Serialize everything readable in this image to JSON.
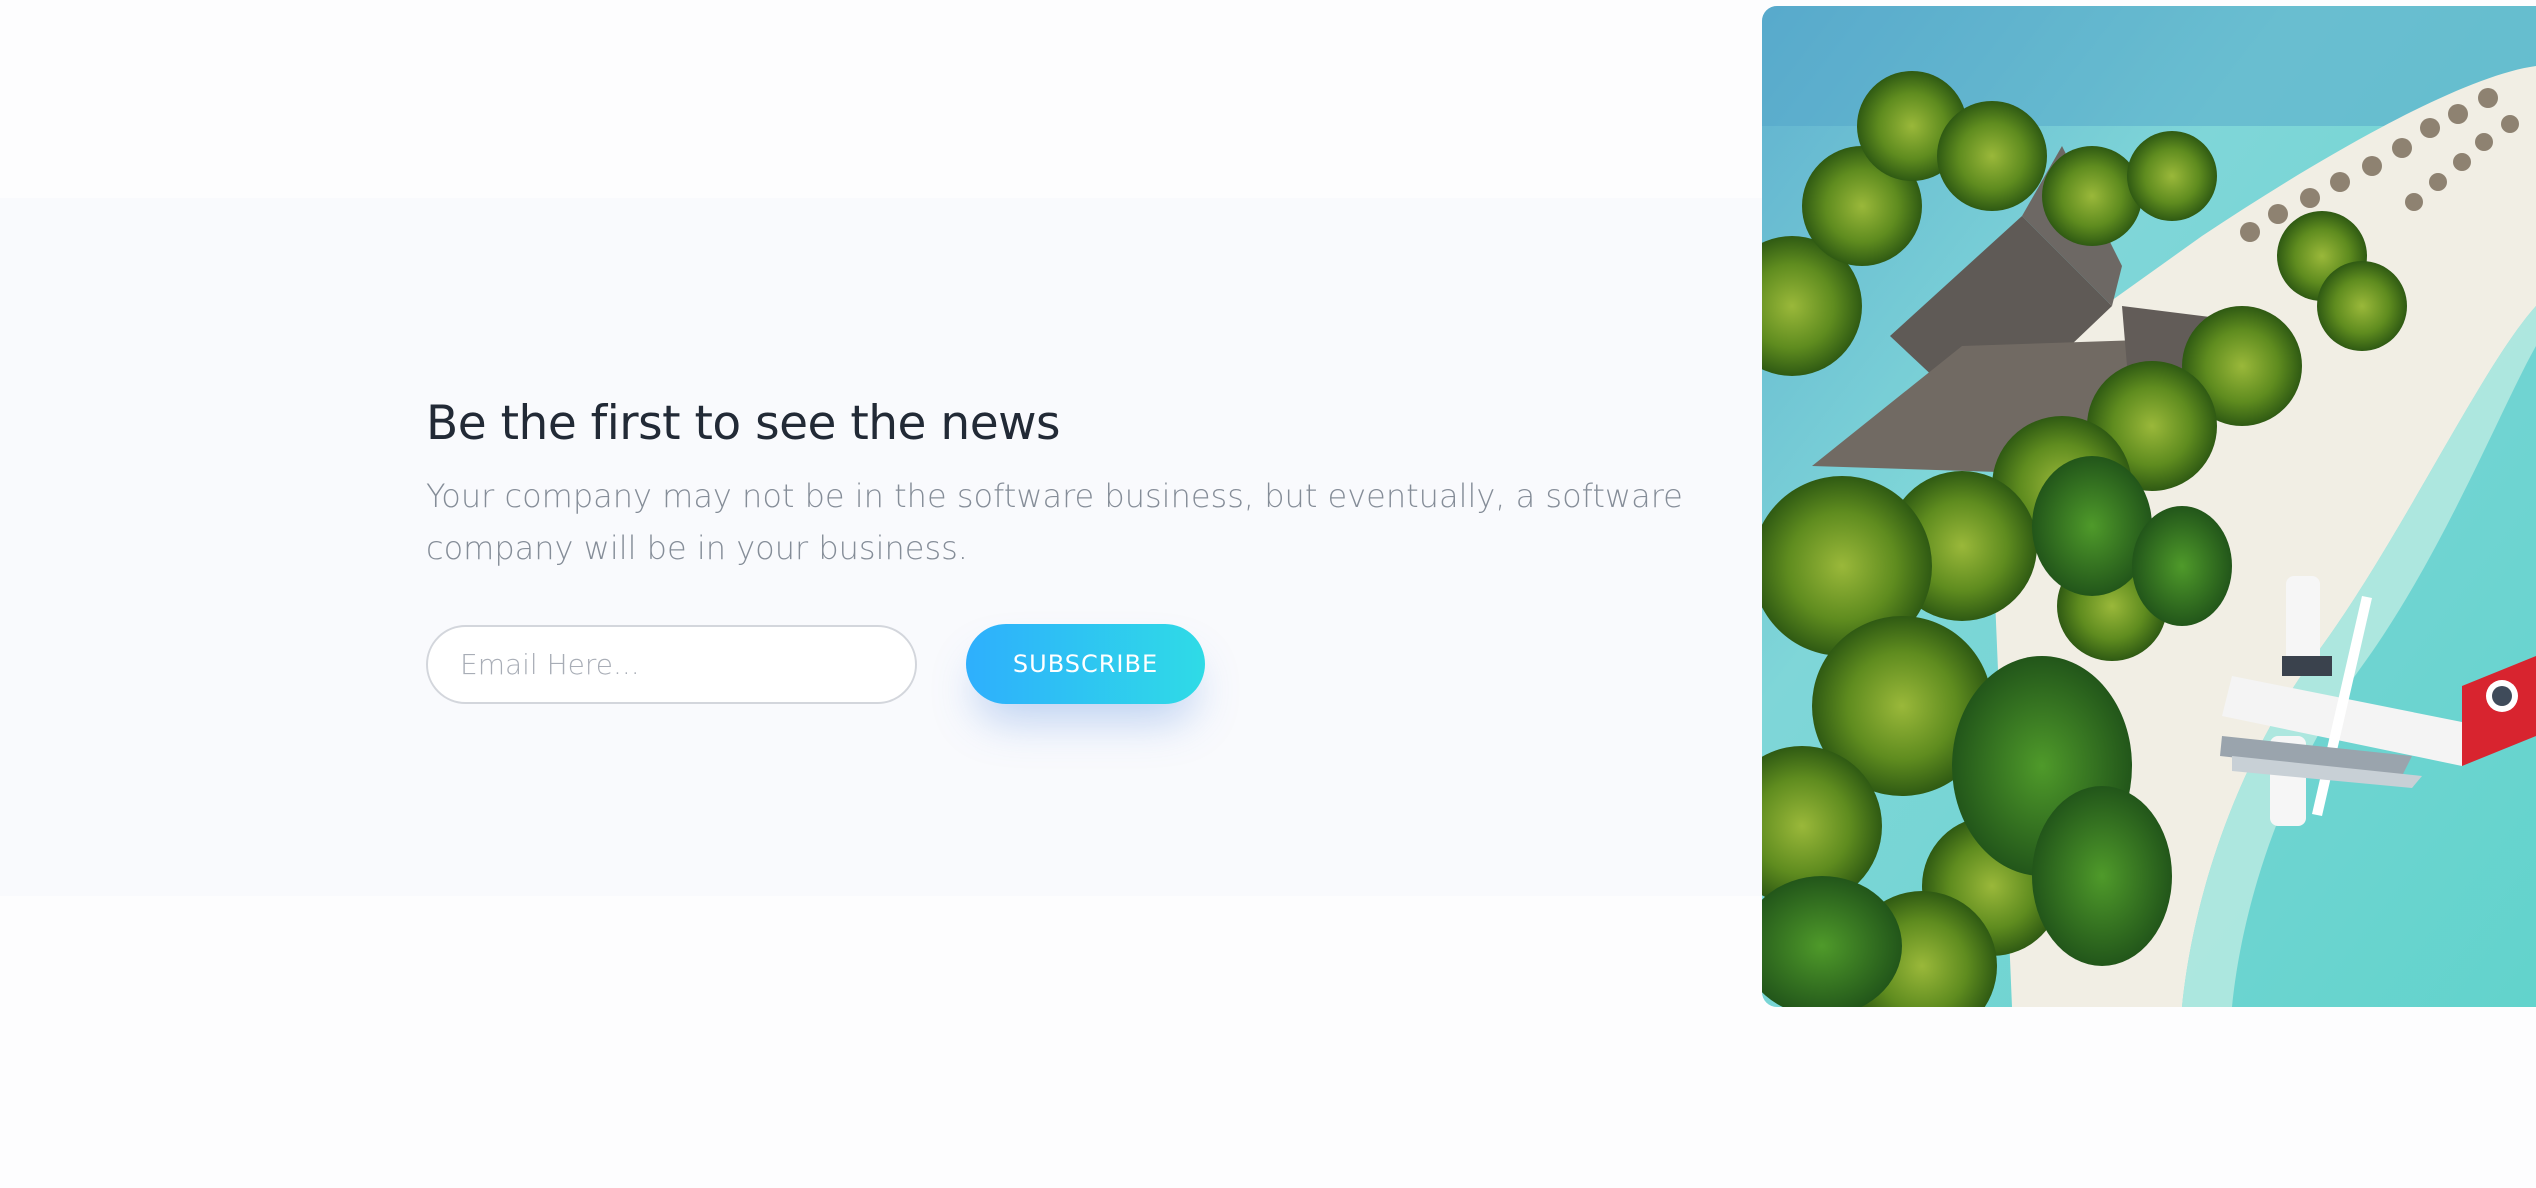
{
  "newsletter": {
    "headline": "Be the first to see the news",
    "lede": "Your company may not be in the software business, but eventually, a software company will be in your business.",
    "email_placeholder": "Email Here...",
    "subscribe_label": "SUBSCRIBE"
  },
  "photo": {
    "subject": "Aerial view of tropical island beach with palm trees, thatched resort, umbrellas and a seaplane"
  },
  "colors": {
    "headline": "#222a36",
    "lede": "#858d98",
    "button_gradient_start": "#2eaffd",
    "button_gradient_end": "#2fdbe6",
    "band_background": "#f9fafd"
  }
}
